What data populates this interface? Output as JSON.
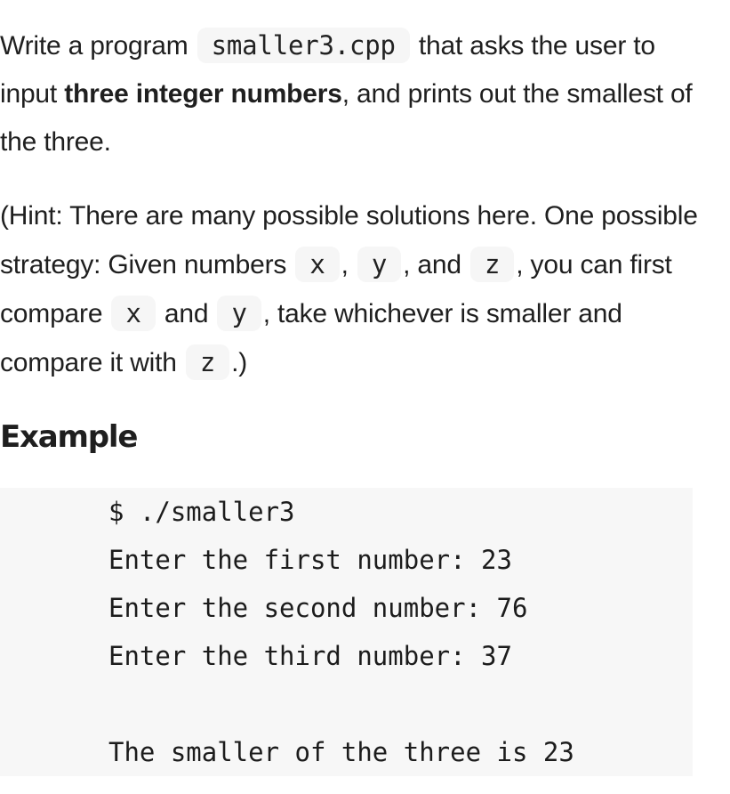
{
  "paragraph1": {
    "text_before_code": "Write a program ",
    "code_filename": "smaller3.cpp",
    "text_after_code": " that asks the user to input ",
    "bold_text": "three integer numbers",
    "text_end": ", and prints out the smallest of the three."
  },
  "paragraph2": {
    "part1": "(Hint: There are many possible solutions here. One possible strategy: Given numbers ",
    "var_x": "x",
    "sep1": ", ",
    "var_y": "y",
    "sep2": ", and ",
    "var_z": "z",
    "part2": ", you can first compare ",
    "var_x2": "x",
    "part3": " and ",
    "var_y2": "y",
    "part4": ", take whichever is smaller and compare it with ",
    "var_z2": "z",
    "part5": ".)"
  },
  "example": {
    "heading": "Example",
    "code_lines": [
      "$ ./smaller3",
      "Enter the first number: 23",
      "Enter the second number: 76",
      "Enter the third number: 37",
      "",
      "The smaller of the three is 23"
    ]
  }
}
